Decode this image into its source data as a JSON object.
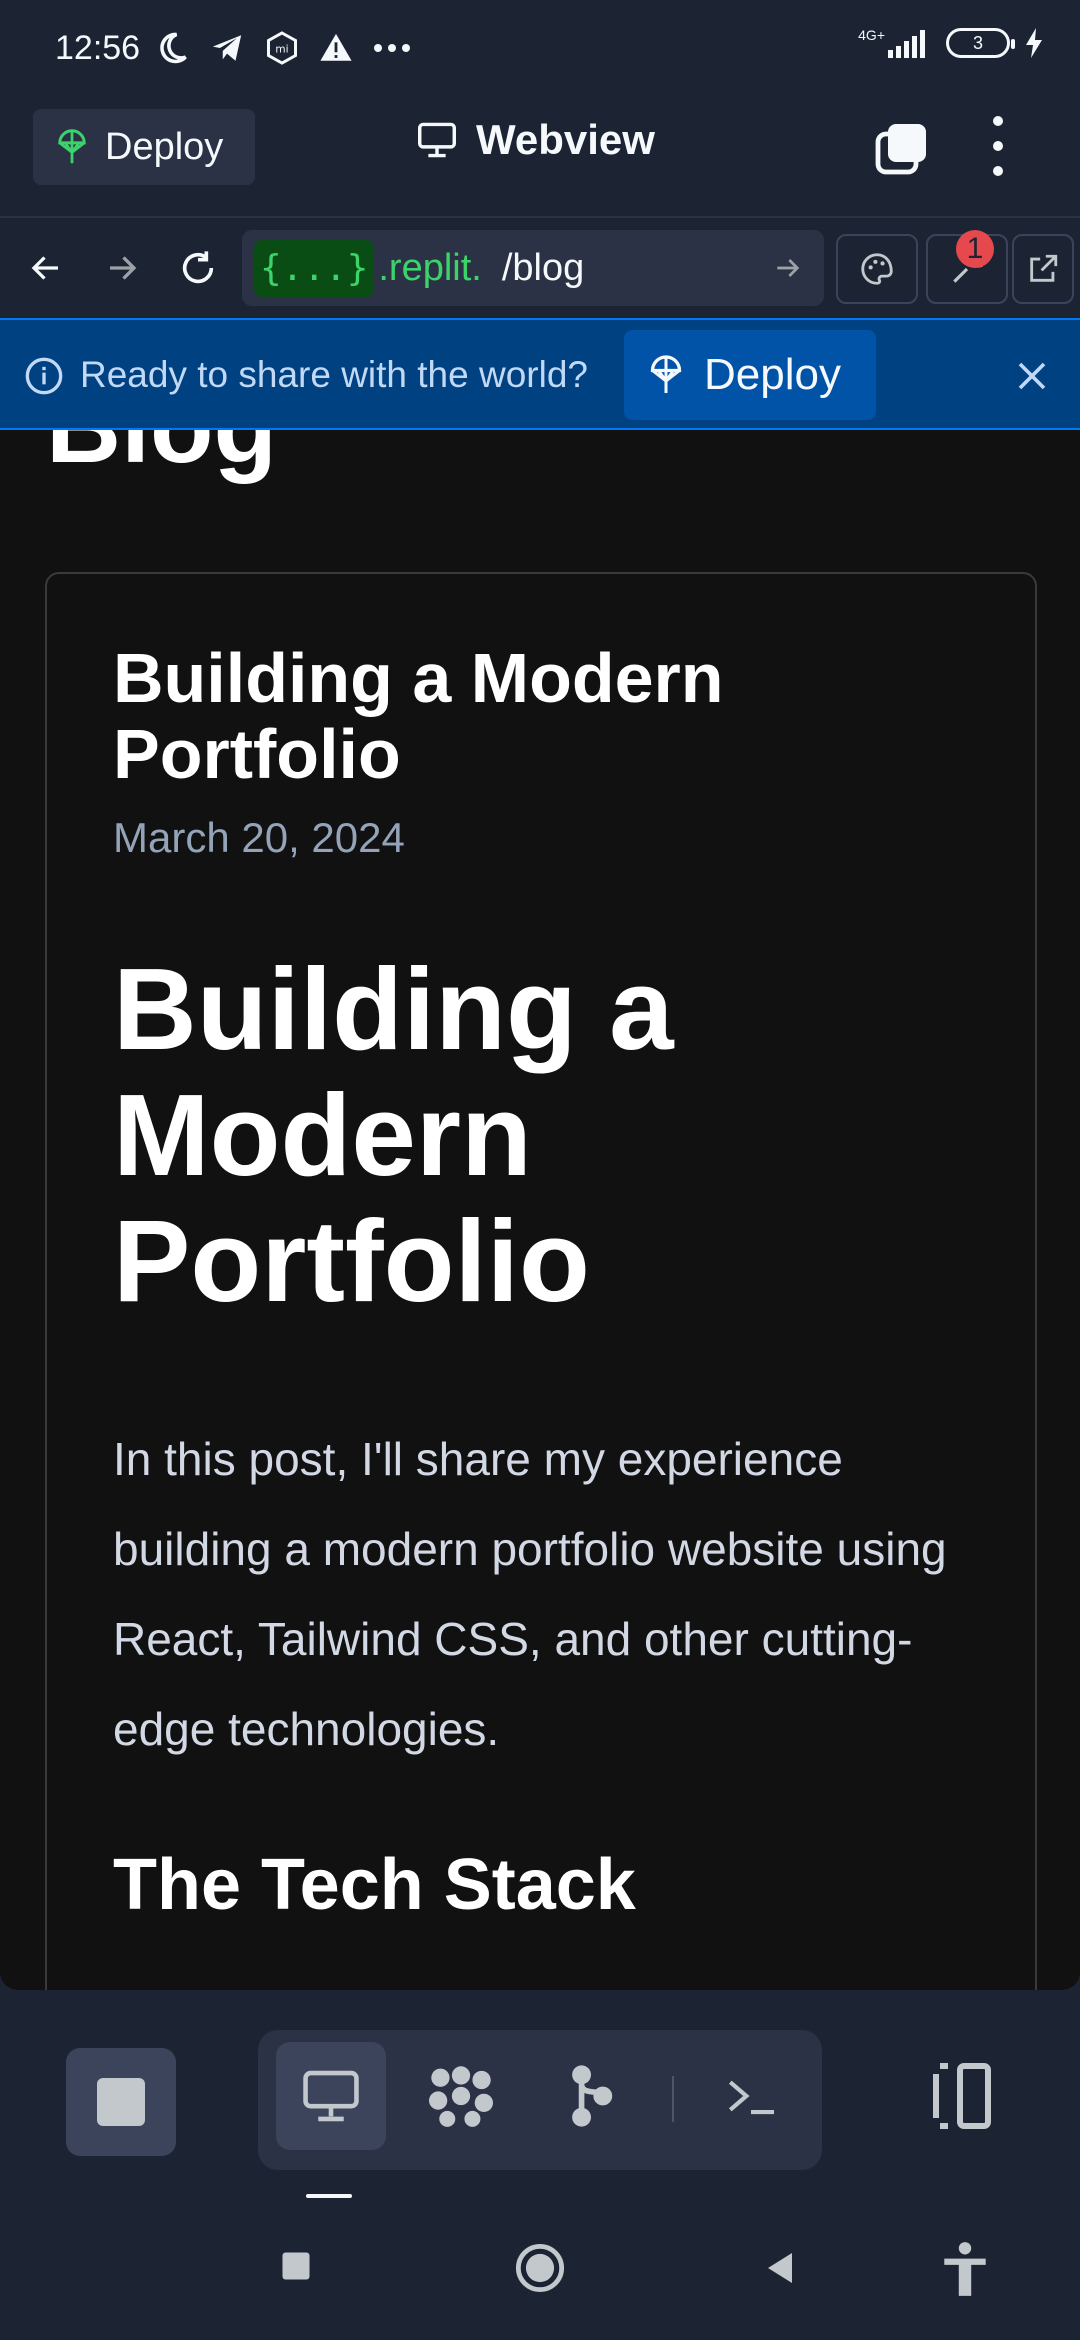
{
  "status_bar": {
    "time": "12:56",
    "network": "4G+",
    "battery": "3"
  },
  "app_bar": {
    "deploy_label": "Deploy",
    "title": "Webview"
  },
  "url_bar": {
    "badge": "{...}",
    "host": ".replit.",
    "path": "/blog",
    "notification_count": "1"
  },
  "banner": {
    "message": "Ready to share with the world?",
    "button_label": "Deploy"
  },
  "page": {
    "heading": "Blog",
    "post": {
      "card_title": "Building a Modern Portfolio",
      "date": "March 20, 2024",
      "title": "Building a Modern Portfolio",
      "body": "In this post, I'll share my experience building a modern portfolio website using React, Tailwind CSS, and other cutting-edge technologies.",
      "section_heading": "The Tech Stack"
    }
  },
  "colors": {
    "background": "#1c2333",
    "surface": "#2b3245",
    "banner": "#004182",
    "accent_green": "#3cd36a",
    "badge_red": "#e5484d"
  },
  "icons": {
    "status": [
      "moon-icon",
      "telegram-icon",
      "mi-icon",
      "warning-icon",
      "more-icon",
      "signal-icon",
      "battery-icon",
      "charging-icon"
    ],
    "bottom_tools": [
      "stop-icon",
      "webview-icon",
      "packages-icon",
      "git-icon",
      "shell-icon",
      "layout-icon"
    ],
    "nav": [
      "recent-apps-icon",
      "home-icon",
      "back-icon",
      "accessibility-icon"
    ]
  }
}
